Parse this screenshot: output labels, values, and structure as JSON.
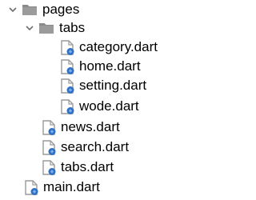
{
  "project_tree": {
    "pages_folder": {
      "label": "pages",
      "expanded": true,
      "icon": "folder-icon"
    },
    "tabs_folder": {
      "label": "tabs",
      "expanded": true,
      "icon": "folder-icon"
    },
    "tabs_files": [
      {
        "label": "category.dart",
        "icon": "dart-file-icon"
      },
      {
        "label": "home.dart",
        "icon": "dart-file-icon"
      },
      {
        "label": "setting.dart",
        "icon": "dart-file-icon"
      },
      {
        "label": "wode.dart",
        "icon": "dart-file-icon"
      }
    ],
    "pages_files": [
      {
        "label": "news.dart",
        "icon": "dart-file-icon"
      },
      {
        "label": "search.dart",
        "icon": "dart-file-icon"
      },
      {
        "label": "tabs.dart",
        "icon": "dart-file-icon"
      }
    ],
    "root_files": [
      {
        "label": "main.dart",
        "icon": "dart-file-icon"
      }
    ]
  },
  "colors": {
    "folder": "#8a8a8a",
    "arrow": "#6e6e6e",
    "file_page": "#9a9a9a",
    "dart_badge": "#2f6fc4",
    "text": "#000000"
  }
}
